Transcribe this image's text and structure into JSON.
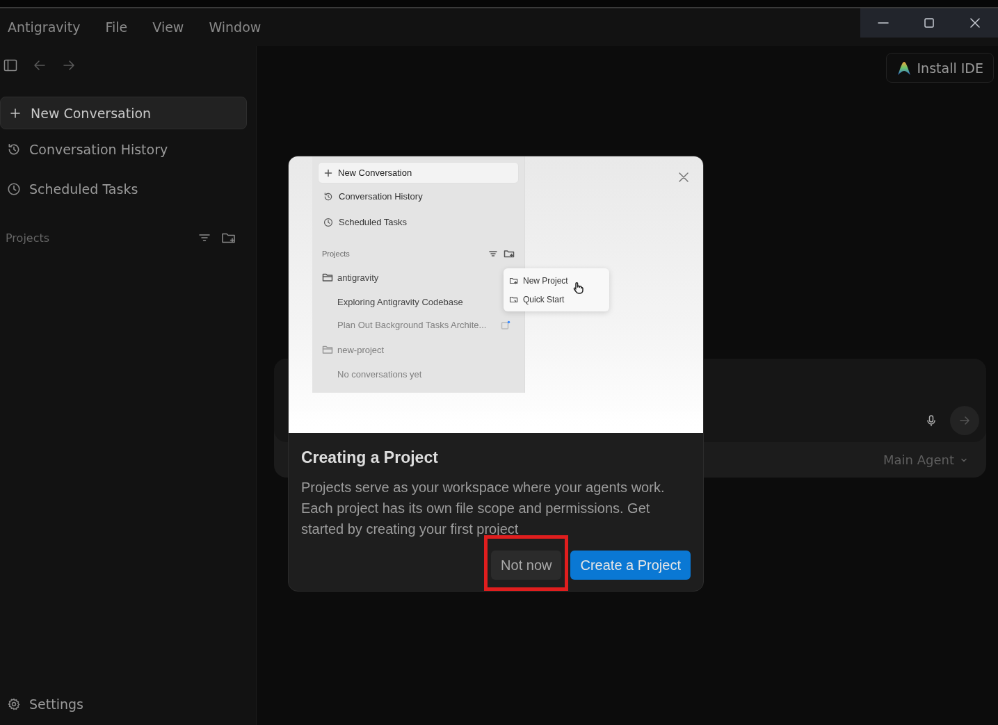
{
  "menu_bar": {
    "items": [
      "Antigravity",
      "File",
      "View",
      "Window"
    ]
  },
  "sidebar": {
    "new_conversation": "New Conversation",
    "items": [
      {
        "label": "Conversation History",
        "kind": "history"
      },
      {
        "label": "Scheduled Tasks",
        "kind": "clock"
      }
    ],
    "projects_title": "Projects",
    "settings": "Settings"
  },
  "header": {
    "install_button": "Install IDE"
  },
  "composer": {
    "agent_selector": "Main Agent"
  },
  "dialog": {
    "preview": {
      "new_conversation": "New Conversation",
      "items": [
        {
          "label": "Conversation History",
          "kind": "history"
        },
        {
          "label": "Scheduled Tasks",
          "kind": "clock"
        }
      ],
      "projects_title": "Projects",
      "projects": [
        {
          "name": "antigravity",
          "faded": false,
          "children": [
            {
              "title": "Exploring Antigravity Codebase",
              "faded": false,
              "unread": false
            },
            {
              "title": "Plan Out Background Tasks Archite...",
              "faded": true,
              "unread": true
            }
          ]
        },
        {
          "name": "new-project",
          "faded": true,
          "children": [
            {
              "title": "No conversations yet",
              "faded": true,
              "unread": false
            }
          ]
        }
      ],
      "menu": [
        {
          "label": "New Project",
          "kind": "folder-plus"
        },
        {
          "label": "Quick Start",
          "kind": "folder-arrow"
        }
      ]
    },
    "title": "Creating a Project",
    "body": "Projects serve as your workspace where your agents work. Each project has its own file scope and permissions. Get started by creating your first project",
    "buttons": [
      {
        "label": "Not now",
        "kind": "secondary",
        "highlighted": true
      },
      {
        "label": "Create a Project",
        "kind": "primary",
        "highlighted": false
      }
    ]
  }
}
